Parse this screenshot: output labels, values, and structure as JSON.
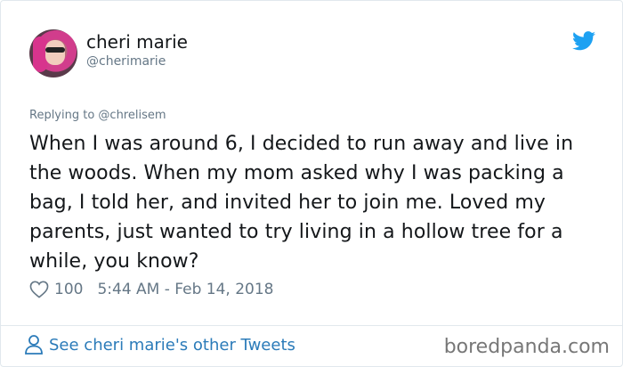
{
  "author": {
    "name": "cheri marie",
    "handle": "@cherimarie",
    "avatar_icon": "avatar"
  },
  "brand": {
    "icon": "twitter-bird-icon",
    "color": "#1da1f2"
  },
  "reply": {
    "text": "Replying to @chrelisem"
  },
  "tweet": {
    "text": "When I was around 6, I decided to run away and live in the woods. When my mom asked why I was packing a bag, I told her, and invited her to join me. Loved my parents, just wanted to try living in a hollow tree for a while, you know?"
  },
  "meta": {
    "like_icon": "heart-icon",
    "likes": "100",
    "timestamp": "5:44 AM - Feb 14, 2018"
  },
  "footer": {
    "see_more": "See cheri marie's other Tweets",
    "icon": "person-icon",
    "link_color": "#2b7bb9"
  },
  "watermark": {
    "text": "boredpanda.com"
  }
}
